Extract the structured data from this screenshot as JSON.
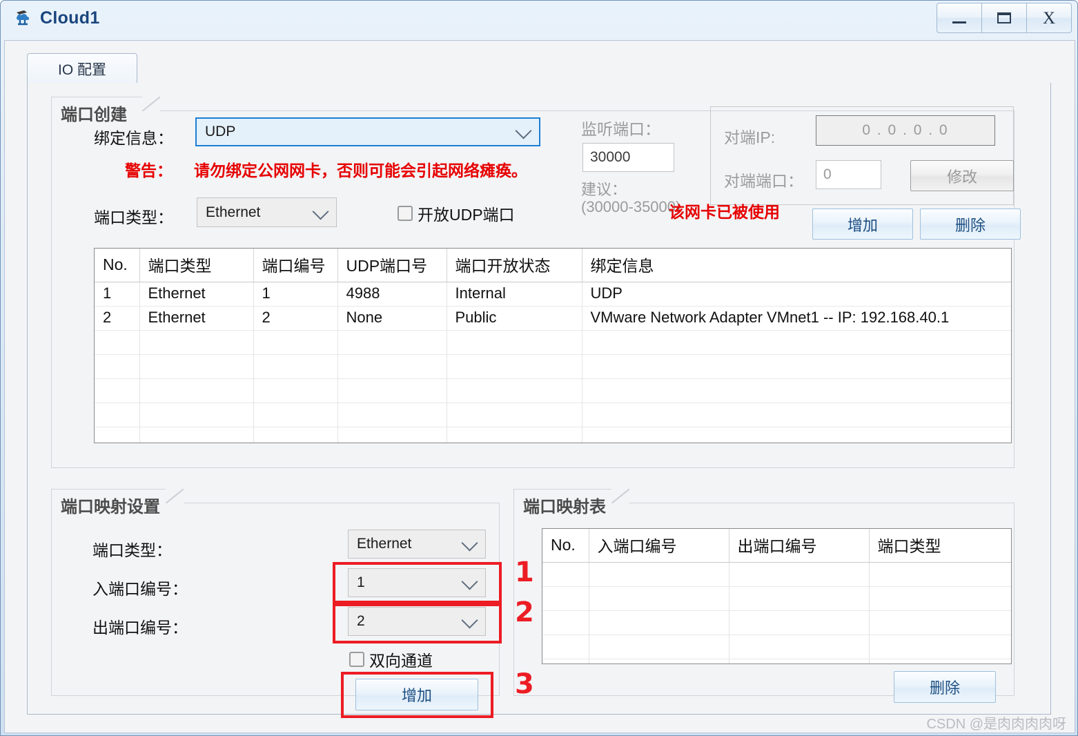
{
  "window": {
    "title": "Cloud1",
    "icon": "cloud-device-icon",
    "buttons": {
      "minimize": "minimize-icon",
      "maximize": "maximize-icon",
      "close": "X"
    }
  },
  "tabs": [
    {
      "label": "IO 配置",
      "selected": true
    }
  ],
  "port_create": {
    "title": "端口创建",
    "binding_label": "绑定信息：",
    "binding_value": "UDP",
    "warning_label": "警告：",
    "warning_text": "请勿绑定公网网卡，否则可能会引起网络瘫痪。",
    "port_type_label": "端口类型：",
    "port_type_value": "Ethernet",
    "open_udp_label": "开放UDP端口",
    "open_udp_checked": false,
    "listen_port_label": "监听端口：",
    "listen_port_value": "30000",
    "suggest_label": "建议：",
    "suggest_range": "(30000-35000)",
    "peer_ip_label": "对端IP:",
    "peer_ip_value": "0  .  0  .  0  .  0",
    "peer_port_label": "对端端口：",
    "peer_port_value": "0",
    "modify_button": "修改",
    "nic_used_warning": "该网卡已被使用",
    "add_button": "增加",
    "delete_button": "删除"
  },
  "port_table": {
    "columns": [
      "No.",
      "端口类型",
      "端口编号",
      "UDP端口号",
      "端口开放状态",
      "绑定信息"
    ],
    "rows": [
      [
        "1",
        "Ethernet",
        "1",
        "4988",
        "Internal",
        "UDP"
      ],
      [
        "2",
        "Ethernet",
        "2",
        "None",
        "Public",
        "VMware Network Adapter VMnet1 -- IP: 192.168.40.1"
      ]
    ],
    "empty_rows": 5
  },
  "mapping_settings": {
    "title": "端口映射设置",
    "port_type_label": "端口类型：",
    "port_type_value": "Ethernet",
    "in_port_label": "入端口编号：",
    "in_port_value": "1",
    "out_port_label": "出端口编号：",
    "out_port_value": "2",
    "bidirectional_label": "双向通道",
    "bidirectional_checked": false,
    "add_button": "增加",
    "annotations": [
      "1",
      "2",
      "3"
    ]
  },
  "mapping_table": {
    "title": "端口映射表",
    "columns": [
      "No.",
      "入端口编号",
      "出端口编号",
      "端口类型"
    ],
    "rows": [],
    "empty_rows": 5,
    "delete_button": "删除"
  },
  "watermark": "CSDN @是肉肉肉肉呀",
  "colors": {
    "accent_blue": "#1a7fd4",
    "title_blue": "#19457e",
    "warning_red": "#e60000",
    "annotation_red": "#ec1c24"
  }
}
